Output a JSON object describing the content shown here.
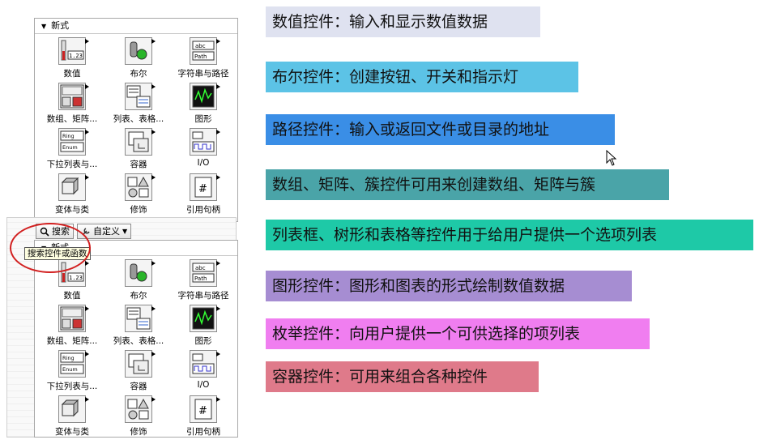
{
  "palette_top": {
    "section": "新式",
    "items": [
      {
        "label": "数值",
        "icon": "numeric-icon"
      },
      {
        "label": "布尔",
        "icon": "boolean-icon"
      },
      {
        "label": "字符串与路径",
        "icon": "string-path-icon"
      },
      {
        "label": "数组、矩阵...",
        "icon": "array-matrix-icon"
      },
      {
        "label": "列表、表格...",
        "icon": "list-table-icon"
      },
      {
        "label": "图形",
        "icon": "graph-icon"
      },
      {
        "label": "下拉列表与...",
        "icon": "ring-enum-icon"
      },
      {
        "label": "容器",
        "icon": "container-icon"
      },
      {
        "label": "I/O",
        "icon": "io-icon"
      },
      {
        "label": "变体与类",
        "icon": "variant-class-icon"
      },
      {
        "label": "修饰",
        "icon": "decorations-icon"
      },
      {
        "label": "引用句柄",
        "icon": "refnum-icon"
      }
    ]
  },
  "toolbar": {
    "search_label": "搜索",
    "customize_label": "自定义",
    "tooltip": "搜索控件或函数"
  },
  "palette_bottom": {
    "section": "新式",
    "items": [
      {
        "label": "数值",
        "icon": "numeric-icon"
      },
      {
        "label": "布尔",
        "icon": "boolean-icon"
      },
      {
        "label": "字符串与路径",
        "icon": "string-path-icon"
      },
      {
        "label": "数组、矩阵...",
        "icon": "array-matrix-icon"
      },
      {
        "label": "列表、表格...",
        "icon": "list-table-icon"
      },
      {
        "label": "图形",
        "icon": "graph-icon"
      },
      {
        "label": "下拉列表与...",
        "icon": "ring-enum-icon"
      },
      {
        "label": "容器",
        "icon": "container-icon"
      },
      {
        "label": "I/O",
        "icon": "io-icon"
      },
      {
        "label": "变体与类",
        "icon": "variant-class-icon"
      },
      {
        "label": "修饰",
        "icon": "decorations-icon"
      },
      {
        "label": "引用句柄",
        "icon": "refnum-icon"
      }
    ]
  },
  "icon_text": {
    "numeric": "1.23",
    "string": "abc",
    "path": "Path",
    "ring": "Ring",
    "enum": "Enum"
  },
  "notes": [
    {
      "text": "数值控件：输入和显示数值数据",
      "color": "#dfe2f0"
    },
    {
      "text": "布尔控件：创建按钮、开关和指示灯",
      "color": "#5cc3e6"
    },
    {
      "text": "路径控件：输入或返回文件或目录的地址",
      "color": "#3a8ee6"
    },
    {
      "text": "数组、矩阵、簇控件可用来创建数组、矩阵与簇",
      "color": "#4aa4a8"
    },
    {
      "text": "列表框、树形和表格等控件用于给用户提供一个选项列表",
      "color": "#1ec9a7"
    },
    {
      "text": "图形控件：图形和图表的形式绘制数值数据",
      "color": "#a68dd2"
    },
    {
      "text": "枚举控件：向用户提供一个可供选择的项列表",
      "color": "#f07ef0"
    },
    {
      "text": "容器控件：可用来组合各种控件",
      "color": "#df7a8a"
    }
  ]
}
